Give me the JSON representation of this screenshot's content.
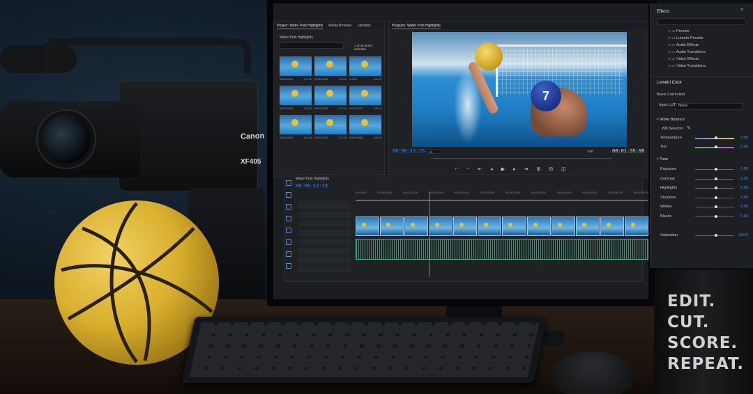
{
  "project_panel": {
    "tabs": [
      "Project: Water Polo Highlights",
      "Media Browser",
      "Libraries"
    ],
    "bin_name": "Water Polo Highlights",
    "items_status": "1 of 45 items selected",
    "thumbs": [
      {
        "name": "0008-0306",
        "dur": "0:8:16"
      },
      {
        "name": "0006-0318",
        "dur": "0:8:16"
      },
      {
        "name": "0:8:16",
        "dur": "0:8:16"
      },
      {
        "name": "0008-0306",
        "dur": "0:8:16"
      },
      {
        "name": "0004-0318",
        "dur": "0:8:16"
      },
      {
        "name": "0008-0316",
        "dur": "0:8:16"
      },
      {
        "name": "0008-0306",
        "dur": "0:8:16"
      },
      {
        "name": "0008-0376",
        "dur": "0:8:16"
      },
      {
        "name": "0008-0306",
        "dur": "0:8:16"
      }
    ]
  },
  "program_monitor": {
    "tab": "Program: Water Polo Highlights",
    "timecode_current": "00:00:12:15",
    "fit": "Fit",
    "quality": "Full",
    "timecode_duration": "00:01:35:08",
    "cap_number": "7"
  },
  "timeline": {
    "tab": "Water Polo Highlights",
    "timecode": "00:00:12:15",
    "ruler": [
      "00:00:00",
      "00:00:05:00",
      "00:00:10:00",
      "00:00:15:00",
      "00:00:20:00",
      "00:00:25:00",
      "00:00:30:00",
      "00:00:35:00",
      "00:00:40:00",
      "00:00:45:00",
      "00:00:50:00",
      "00:00:55:00"
    ]
  },
  "effects_panel": {
    "title": "Effects",
    "items": [
      "Presets",
      "Lumetri Presets",
      "Audio Effects",
      "Audio Transitions",
      "Video Effects",
      "Video Transitions"
    ]
  },
  "lumetri": {
    "title": "Lumetri Color",
    "basic_correction": "Basic Correction",
    "input_lut_label": "Input LUT",
    "input_lut_value": "None",
    "white_balance": "White Balance",
    "wb_selector": "WB Selector",
    "temperature": {
      "label": "Temperature",
      "value": "0.00"
    },
    "tint": {
      "label": "Tint",
      "value": "0.00"
    },
    "tone": "Tone",
    "exposure": {
      "label": "Exposure",
      "value": "0.00"
    },
    "contrast": {
      "label": "Contrast",
      "value": "0.00"
    },
    "highlights": {
      "label": "Highlights",
      "value": "0.00"
    },
    "shadows": {
      "label": "Shadows",
      "value": "0.00"
    },
    "whites": {
      "label": "Whites",
      "value": "0.00"
    },
    "blacks": {
      "label": "Blacks",
      "value": "0.00"
    },
    "saturation": {
      "label": "Saturation",
      "value": "100.0"
    }
  },
  "camera": {
    "brand": "Canon",
    "model": "XF405"
  },
  "mug": {
    "lines": [
      "EDIT.",
      "CUT.",
      "SCORE.",
      "REPEAT."
    ]
  },
  "colors": {
    "accent_blue": "#3b8cff",
    "audio_green": "#1e8f6a",
    "ball_yellow": "#e0b733"
  }
}
